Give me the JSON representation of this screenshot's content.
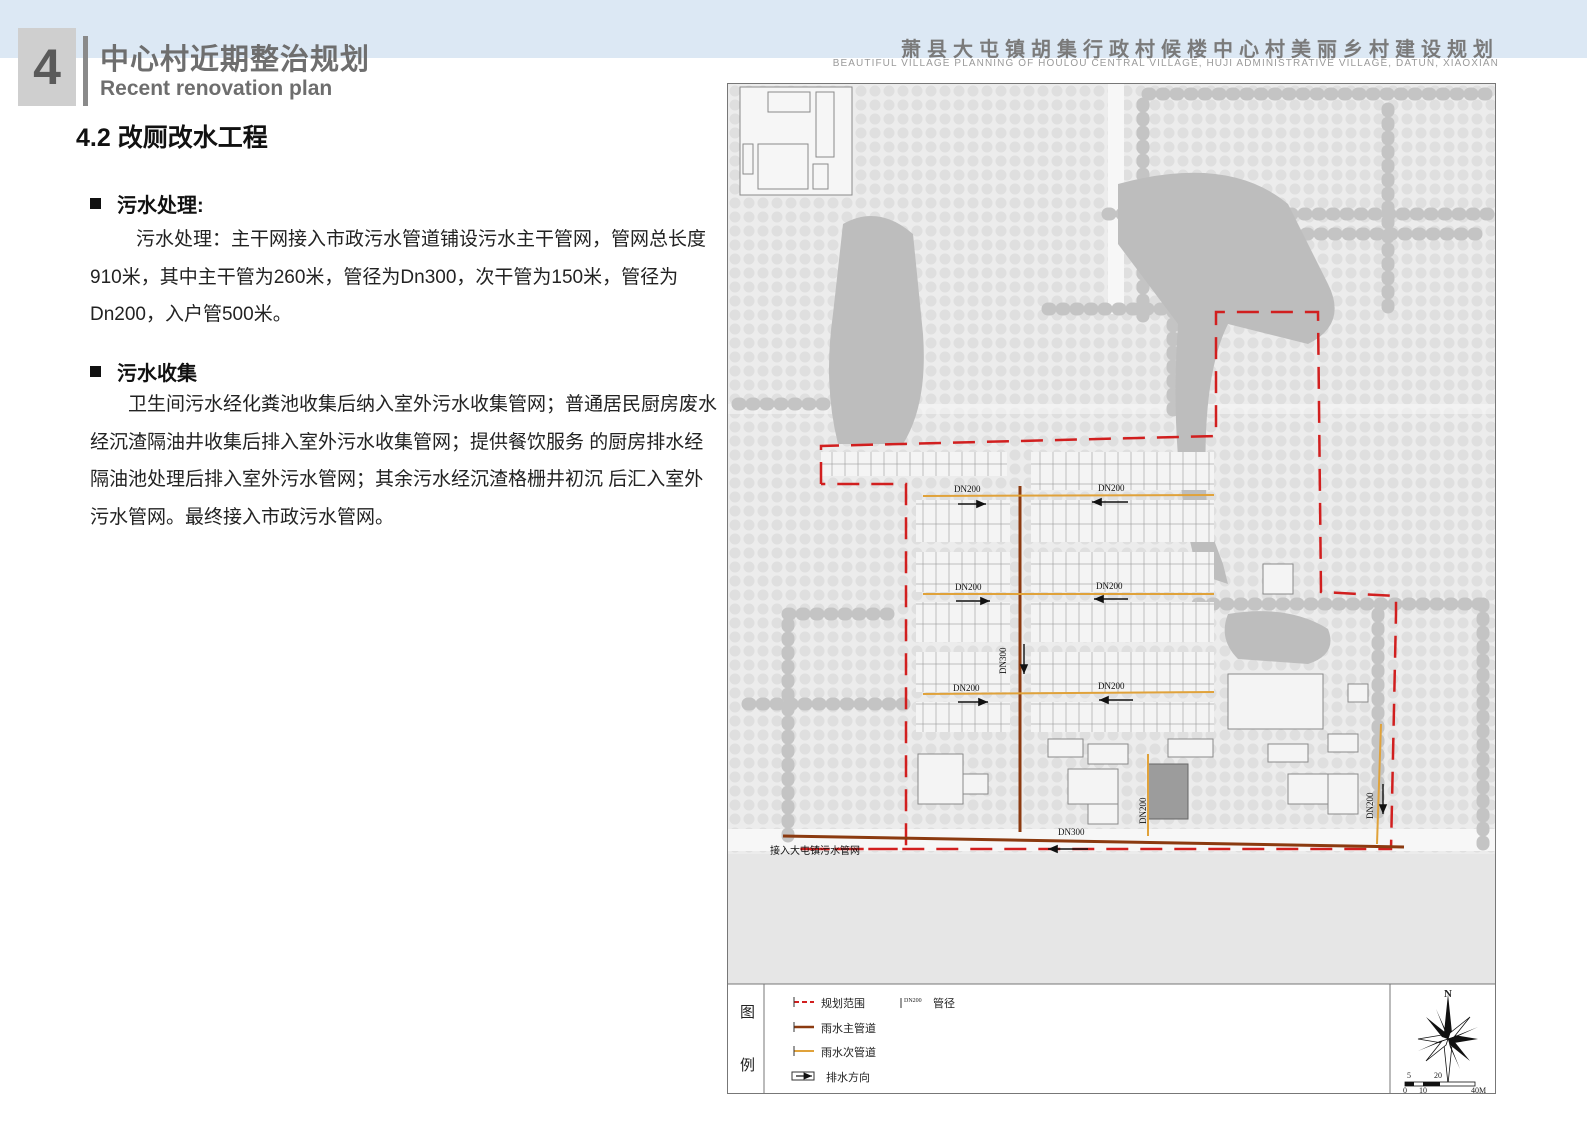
{
  "header": {
    "chapter_number": "4",
    "title_cn": "中心村近期整治规划",
    "title_en": "Recent renovation plan",
    "project_cn": "萧县大屯镇胡集行政村候楼中心村美丽乡村建设规划",
    "project_en": "BEAUTIFUL VILLAGE PLANNING OF HOULOU CENTRAL VILLAGE, HUJI ADMINISTRATIVE VILLAGE, DATUN, XIAOXIAN"
  },
  "section": {
    "title": "4.2 改厕改水工程",
    "sewage_treatment": {
      "heading": "污水处理:",
      "body": "污水处理：主干网接入市政污水管道铺设污水主干管网，管网总长度910米，其中主干管为260米，管径为Dn300，次干管为150米，管径为Dn200，入户管500米。"
    },
    "sewage_collection": {
      "heading": "污水收集",
      "body": "卫生间污水经化粪池收集后纳入室外污水收集管网；普通居民厨房废水经沉渣隔油井收集后排入室外污水收集管网；提供餐饮服务 的厨房排水经隔油池处理后排入室外污水管网；其余污水经沉渣格栅井初沉 后汇入室外污水管网。最终接入市政污水管网。"
    }
  },
  "map": {
    "pipe_labels": {
      "dn200": "DN200",
      "dn300": "DN300",
      "connect_note": "接入大屯镇污水管网"
    },
    "legend": {
      "title_top": "图",
      "title_bottom": "例",
      "items": [
        {
          "label": "规划范围",
          "color": "#d11f1f"
        },
        {
          "label": "雨水主管道",
          "color": "#8b3a10"
        },
        {
          "label": "雨水次管道",
          "color": "#e0a23a"
        },
        {
          "label": "排水方向",
          "color": "#222222"
        }
      ],
      "pipe_size_sample": "DN200",
      "pipe_size_label": "管径"
    },
    "north_label": "N",
    "scale_top": [
      "5",
      "20"
    ],
    "scale_bottom": [
      "0",
      "10",
      "40M"
    ],
    "colors": {
      "boundary": "#d11f1f",
      "main_pipe": "#8b3a10",
      "secondary_pipe": "#e0a23a",
      "tree": "#c9c9c9",
      "water": "#bdbdbd"
    }
  }
}
